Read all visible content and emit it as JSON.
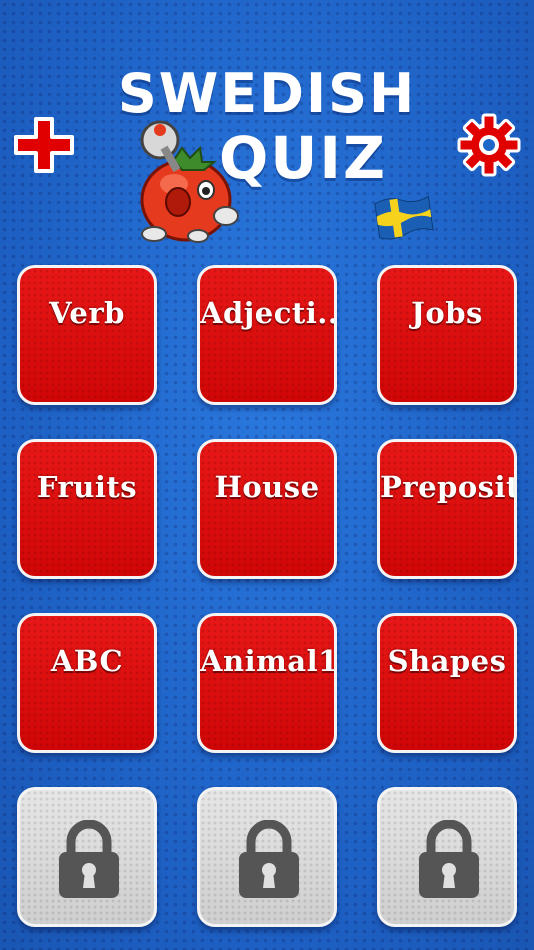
{
  "header": {
    "title_line1": "SWEDISH",
    "title_line2": "QUIZ",
    "add_icon": "plus-icon",
    "settings_icon": "gear-icon",
    "flag_icon": "swedish-flag-icon",
    "mascot_icon": "tomato-mascot-icon"
  },
  "colors": {
    "background": "#1f66c9",
    "tile_red": "#dd0b0b",
    "tile_locked": "#d7d7d7",
    "accent_red": "#e00000"
  },
  "categories": [
    "Verb",
    "Adjecti...",
    "Jobs",
    "Fruits",
    "House",
    "Preposit...",
    "ABC",
    "Animal1",
    "Shapes"
  ],
  "locked_tiles": [
    {
      "icon": "lock-icon"
    },
    {
      "icon": "lock-icon"
    },
    {
      "icon": "lock-icon"
    }
  ]
}
